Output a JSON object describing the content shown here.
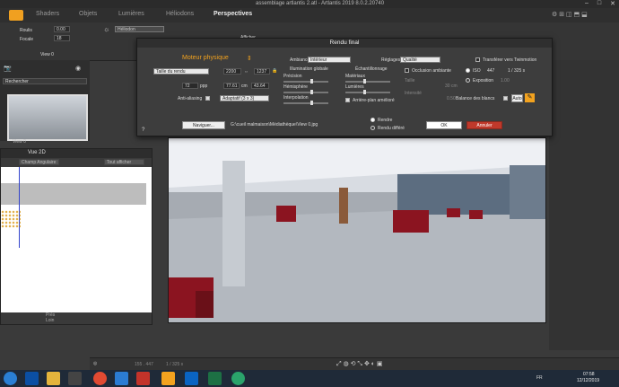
{
  "app": {
    "title": "assemblage artlantis 2.atl - Artlantis 2019 8.0.2.20740"
  },
  "menu": {
    "shaders": "Shaders",
    "objets": "Objets",
    "lumieres": "Lumières",
    "heliodons": "Héliodons",
    "perspectives": "Perspectives"
  },
  "toolbar": {
    "roulis_label": "Roulis",
    "roulis_value": "0.00",
    "focale_label": "Focale",
    "focale_value": "18",
    "view_label": "View 0",
    "heliodon_label": "Héliodon",
    "afficher_label": "Afficher"
  },
  "left_panel": {
    "rechercher": "Rechercher",
    "thumb_label": "View 0"
  },
  "vue2d": {
    "title": "Vue 2D",
    "champ": "Champ Angulaire",
    "tout_afficher": "Tout afficher",
    "pres": "Près",
    "loin": "Loin"
  },
  "dialog": {
    "title": "Rendu final",
    "moteur": "Moteur physique",
    "taille_label": "Taille du rendu",
    "width": "2200",
    "height": "1237",
    "width_cm": "77.61",
    "unit_cm": "cm",
    "height_cm": "43.64",
    "ppp": "72",
    "ppp_unit": "ppp",
    "antialiasing_label": "Anti-aliasing",
    "antialiasing_value": "Adaptatif (3 x 3)",
    "ambiance_label": "Ambiance",
    "ambiance_value": "Intérieur",
    "reglages_label": "Réglages",
    "reglages_value": "Qualité",
    "twinmotion": "Transférer vers Twinmotion",
    "illum_title": "Illumination globale",
    "precision": "Précision",
    "hemisphere": "Hémisphère",
    "interpolation": "Interpolation",
    "echant_title": "Échantillonnage",
    "materiaux": "Matériaux",
    "lumieres": "Lumières",
    "arriere_plan": "Arrière-plan amélioré",
    "occlusion": "Occlusion ambiante",
    "taille": "Taille",
    "taille_val": "30 cm",
    "intensite": "Intensité",
    "intensite_val": "0.50",
    "iso_label": "ISO",
    "iso_value": "447",
    "shutter": "1 / 325 s",
    "exposition": "Exposition",
    "expo_value": "1.00",
    "balance": "Balance des blancs",
    "auto": "Auto",
    "naviguer": "Naviguer...",
    "path": "G:\\cueil malmaison\\Médiathèque\\View 0.jpg",
    "rendre": "Rendre",
    "rendu_differe": "Rendu différé",
    "ok": "OK",
    "annuler": "Annuler",
    "help": "?"
  },
  "statusbar": {
    "coords": "155 . 447",
    "scale": "1 / 325 s"
  },
  "taskbar": {
    "lang": "FR",
    "time": "07:58",
    "date": "12/12/2019"
  },
  "colors": {
    "accent": "#f2a21f",
    "cancel": "#c0392b",
    "sofa": "#8b1420"
  }
}
